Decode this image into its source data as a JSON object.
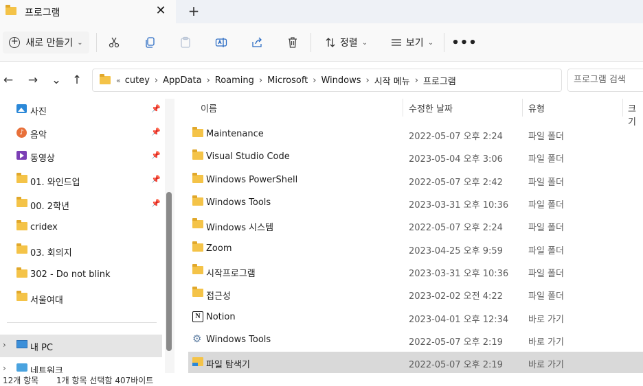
{
  "tab": {
    "title": "프로그램",
    "close": "✕",
    "new_tab": "+"
  },
  "toolbar": {
    "new_label": "새로 만들기",
    "new_plus": "+",
    "sort_label": "정렬",
    "view_label": "보기",
    "more": "•••",
    "chevron": "⌄"
  },
  "nav_buttons": {
    "back": "←",
    "forward": "→",
    "recent": "⌄",
    "up": "↑"
  },
  "address": {
    "overflow": "«",
    "crumbs": [
      "cutey",
      "AppData",
      "Roaming",
      "Microsoft",
      "Windows",
      "시작 메뉴",
      "프로그램"
    ],
    "separator": "›",
    "dropdown": "⌄",
    "refresh": "↻"
  },
  "search": {
    "placeholder": "프로그램 검색"
  },
  "sidebar": {
    "items": [
      {
        "label": "사진",
        "icon": "photos-icon",
        "pinned": true
      },
      {
        "label": "음악",
        "icon": "music-icon",
        "pinned": true
      },
      {
        "label": "동영상",
        "icon": "videos-icon",
        "pinned": true
      },
      {
        "label": "01. 와인드업",
        "icon": "folder-icon",
        "pinned": true
      },
      {
        "label": "00. 2학년",
        "icon": "folder-icon",
        "pinned": true
      },
      {
        "label": "cridex",
        "icon": "folder-icon",
        "pinned": false
      },
      {
        "label": "03. 회의지",
        "icon": "folder-icon",
        "pinned": false
      },
      {
        "label": "302 - Do not blink",
        "icon": "folder-icon",
        "pinned": false
      },
      {
        "label": "서울여대",
        "icon": "folder-icon",
        "pinned": false
      }
    ],
    "pin_glyph": "📌",
    "expander": "›",
    "this_pc": "내 PC",
    "network": "네트워크"
  },
  "columns": {
    "name": "이름",
    "modified": "수정한 날짜",
    "type": "유형",
    "size": "크기",
    "sort_caret": "^"
  },
  "files": [
    {
      "name": "Maintenance",
      "date": "2022-05-07 오후 2:24",
      "type": "파일 폴더",
      "icon": "folder-icon"
    },
    {
      "name": "Visual Studio Code",
      "date": "2023-05-04 오후 3:06",
      "type": "파일 폴더",
      "icon": "folder-icon"
    },
    {
      "name": "Windows PowerShell",
      "date": "2022-05-07 오후 2:42",
      "type": "파일 폴더",
      "icon": "folder-icon"
    },
    {
      "name": "Windows Tools",
      "date": "2023-03-31 오후 10:36",
      "type": "파일 폴더",
      "icon": "folder-icon"
    },
    {
      "name": "Windows 시스템",
      "date": "2022-05-07 오후 2:24",
      "type": "파일 폴더",
      "icon": "folder-icon"
    },
    {
      "name": "Zoom",
      "date": "2023-04-25 오후 9:59",
      "type": "파일 폴더",
      "icon": "folder-icon"
    },
    {
      "name": "시작프로그램",
      "date": "2023-03-31 오후 10:36",
      "type": "파일 폴더",
      "icon": "folder-icon"
    },
    {
      "name": "접근성",
      "date": "2023-02-02 오전 4:22",
      "type": "파일 폴더",
      "icon": "folder-icon"
    },
    {
      "name": "Notion",
      "date": "2023-04-01 오후 12:34",
      "type": "바로 가기",
      "icon": "notion-shortcut-icon"
    },
    {
      "name": "Windows Tools",
      "date": "2022-05-07 오후 2:19",
      "type": "바로 가기",
      "icon": "windows-tools-shortcut-icon"
    },
    {
      "name": "파일 탐색기",
      "date": "2022-05-07 오후 2:19",
      "type": "바로 가기",
      "icon": "file-explorer-shortcut-icon",
      "selected": true
    }
  ],
  "status": {
    "item_count": "12개 항목",
    "selection": "1개 항목 선택함 407바이트"
  }
}
